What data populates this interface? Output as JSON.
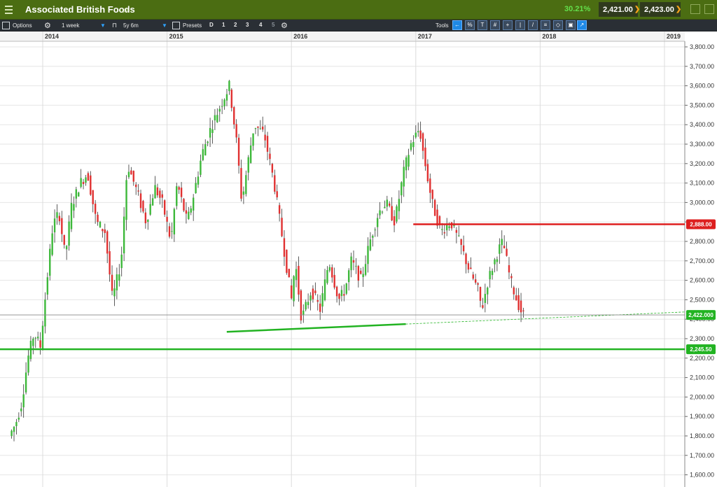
{
  "header": {
    "title": "Associated British Foods",
    "change_pct": "30.21%",
    "bid": "2,421.00",
    "ask": "2,423.00"
  },
  "toolbar": {
    "options_label": "Options",
    "interval": "1 week",
    "range": "5y 6m",
    "presets_label": "Presets",
    "presets": [
      "D",
      "1",
      "2",
      "3",
      "4",
      "5"
    ],
    "tools_label": "Tools"
  },
  "colors": {
    "up": "#3db83a",
    "down": "#e03131",
    "support": "#22b322",
    "resistance": "#dd1f1f",
    "title_bar": "#4b6d12"
  },
  "chart_data": {
    "type": "candlestick",
    "interval": "1 week",
    "xlabel": "",
    "ylabel": "",
    "x_ticks": [
      "2014",
      "2015",
      "2016",
      "2017",
      "2018",
      "2019"
    ],
    "y_ticks": [
      "1,600.00",
      "1,700.00",
      "1,800.00",
      "1,900.00",
      "2,000.00",
      "2,100.00",
      "2,200.00",
      "2,300.00",
      "2,400.00",
      "2,500.00",
      "2,600.00",
      "2,700.00",
      "2,800.00",
      "2,900.00",
      "3,000.00",
      "3,100.00",
      "3,200.00",
      "3,300.00",
      "3,400.00",
      "3,500.00",
      "3,600.00",
      "3,700.00",
      "3,800.00"
    ],
    "ylim": [
      1560,
      3800
    ],
    "xlim": [
      2013.73,
      2019.2
    ],
    "grid": true,
    "price_path": [
      [
        2013.75,
        1800
      ],
      [
        2013.8,
        1860
      ],
      [
        2013.85,
        1970
      ],
      [
        2013.9,
        2200
      ],
      [
        2013.95,
        2330
      ],
      [
        2014.0,
        2260
      ],
      [
        2014.05,
        2580
      ],
      [
        2014.1,
        2880
      ],
      [
        2014.15,
        2950
      ],
      [
        2014.2,
        2720
      ],
      [
        2014.25,
        2980
      ],
      [
        2014.32,
        3100
      ],
      [
        2014.38,
        3150
      ],
      [
        2014.45,
        2900
      ],
      [
        2014.52,
        2850
      ],
      [
        2014.58,
        2500
      ],
      [
        2014.65,
        2700
      ],
      [
        2014.7,
        3200
      ],
      [
        2014.78,
        3050
      ],
      [
        2014.85,
        2900
      ],
      [
        2014.92,
        3080
      ],
      [
        2014.98,
        3000
      ],
      [
        2015.05,
        2800
      ],
      [
        2015.1,
        3100
      ],
      [
        2015.18,
        2900
      ],
      [
        2015.22,
        3000
      ],
      [
        2015.3,
        3250
      ],
      [
        2015.38,
        3400
      ],
      [
        2015.45,
        3500
      ],
      [
        2015.52,
        3600
      ],
      [
        2015.58,
        3300
      ],
      [
        2015.62,
        3000
      ],
      [
        2015.68,
        3250
      ],
      [
        2015.72,
        3400
      ],
      [
        2015.8,
        3350
      ],
      [
        2015.88,
        3100
      ],
      [
        2015.95,
        2800
      ],
      [
        2016.02,
        2500
      ],
      [
        2016.05,
        2700
      ],
      [
        2016.1,
        2400
      ],
      [
        2016.18,
        2550
      ],
      [
        2016.25,
        2450
      ],
      [
        2016.32,
        2700
      ],
      [
        2016.4,
        2500
      ],
      [
        2016.45,
        2550
      ],
      [
        2016.5,
        2700
      ],
      [
        2016.58,
        2600
      ],
      [
        2016.65,
        2800
      ],
      [
        2016.72,
        2950
      ],
      [
        2016.78,
        3000
      ],
      [
        2016.85,
        2900
      ],
      [
        2016.92,
        3150
      ],
      [
        2016.98,
        3300
      ],
      [
        2017.05,
        3380
      ],
      [
        2017.08,
        3250
      ],
      [
        2017.15,
        3000
      ],
      [
        2017.22,
        2850
      ],
      [
        2017.3,
        2900
      ],
      [
        2017.38,
        2780
      ],
      [
        2017.45,
        2650
      ],
      [
        2017.52,
        2550
      ],
      [
        2017.55,
        2450
      ],
      [
        2017.6,
        2600
      ],
      [
        2017.68,
        2750
      ],
      [
        2017.72,
        2800
      ],
      [
        2017.78,
        2600
      ],
      [
        2017.83,
        2500
      ],
      [
        2017.88,
        2420
      ]
    ],
    "annotations": [
      {
        "type": "resistance",
        "label": "2,888.00",
        "value": 2888.0,
        "from": 2016.98,
        "color": "#dd1f1f"
      },
      {
        "type": "support",
        "label": "2,245.50",
        "value": 2245.5,
        "color": "#22b322"
      },
      {
        "type": "trendline",
        "points": [
          [
            2015.48,
            2335
          ],
          [
            2016.92,
            2375
          ]
        ],
        "color": "#22b322"
      },
      {
        "type": "current_price",
        "label": "2,422.000",
        "value": 2422.0,
        "color": "#22b322"
      }
    ]
  }
}
